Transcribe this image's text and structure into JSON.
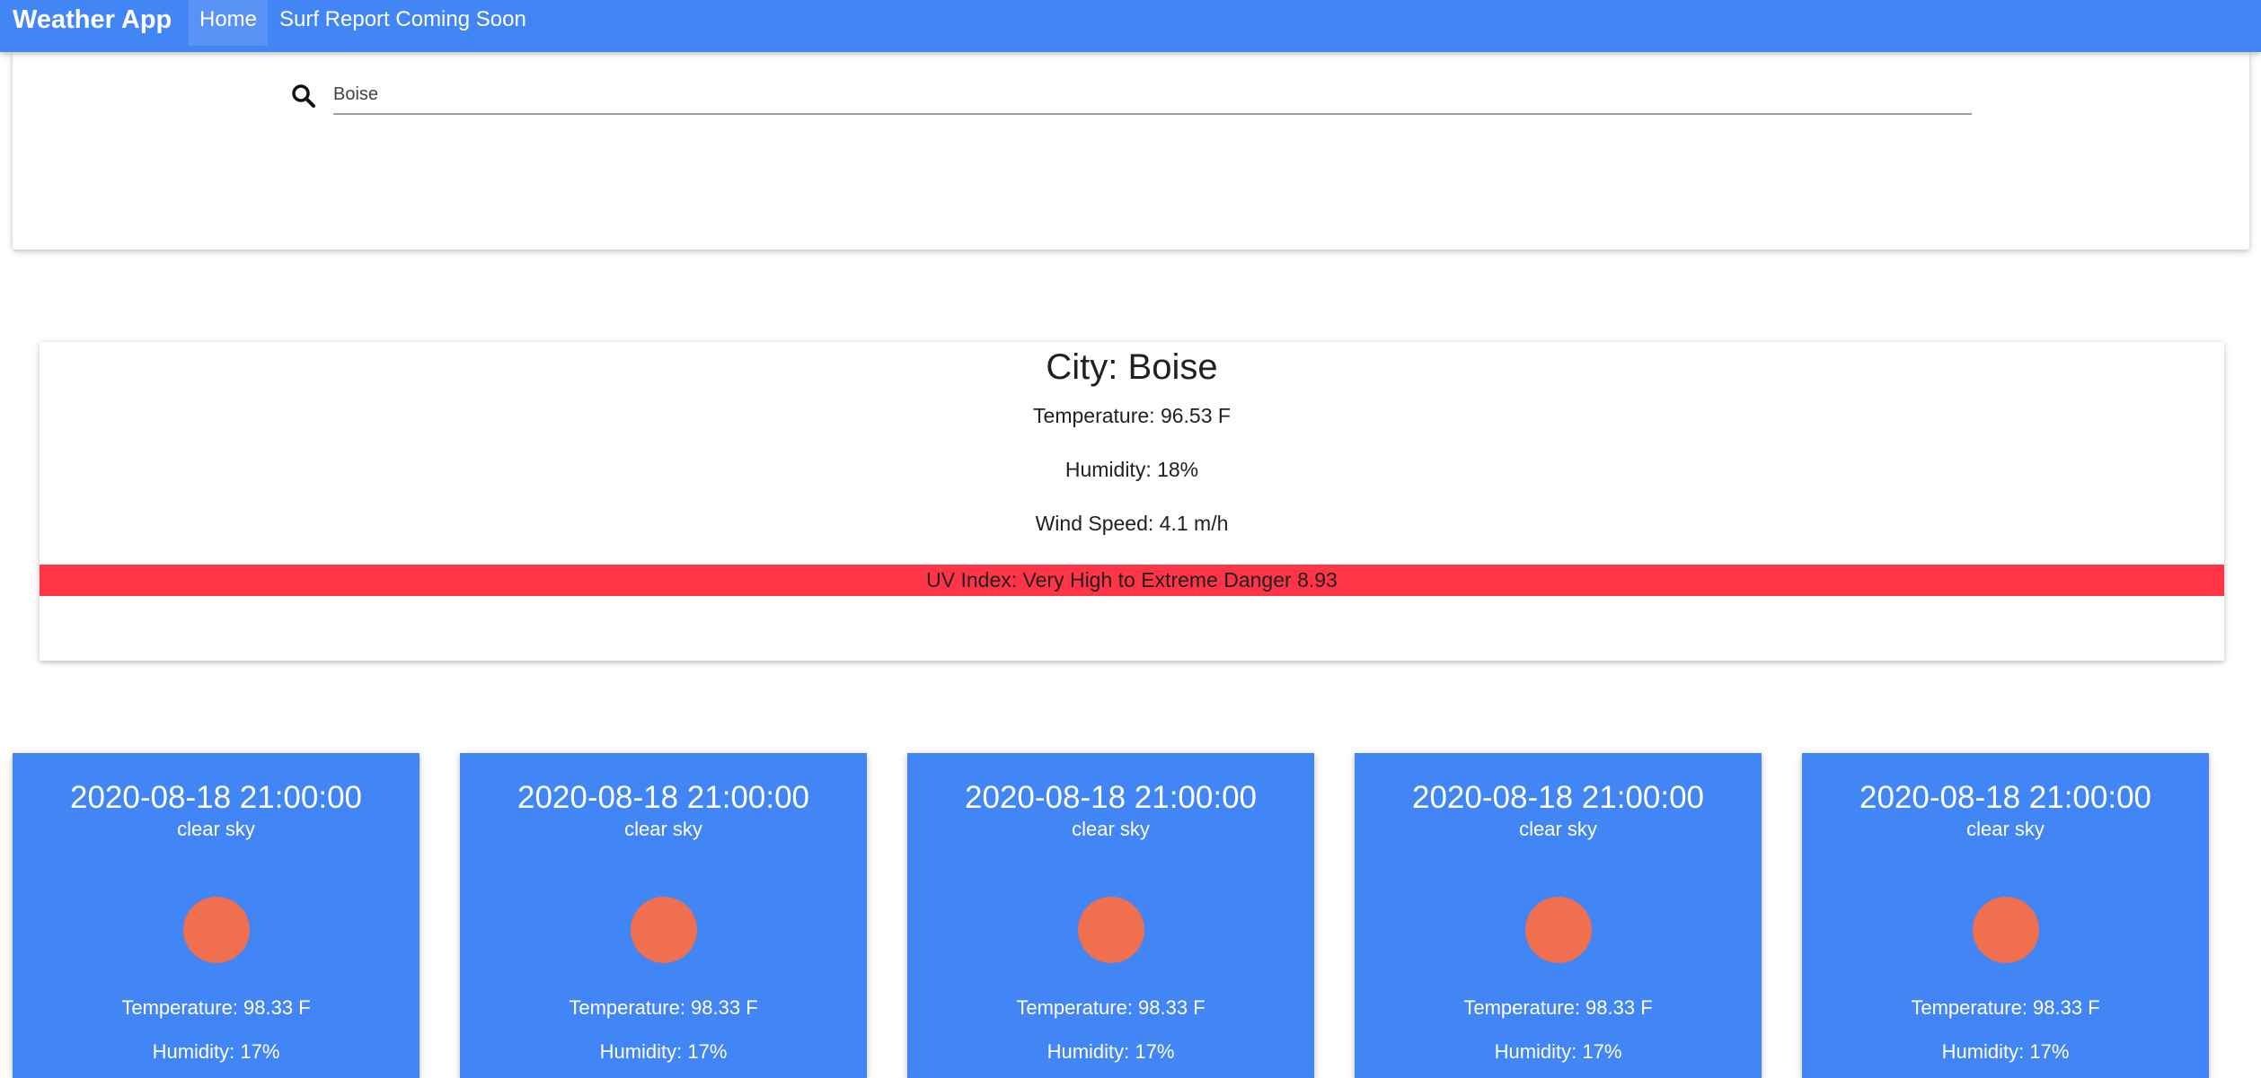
{
  "navbar": {
    "brand": "Weather App",
    "links": [
      {
        "label": "Home",
        "active": true
      },
      {
        "label": "Surf Report Coming Soon",
        "active": false
      }
    ],
    "color": "#4285f4"
  },
  "search": {
    "value": "Boise",
    "icon": "search-icon"
  },
  "current": {
    "city": "City: Boise",
    "temperature": "Temperature: 96.53 F",
    "humidity": "Humidity: 18%",
    "wind_speed": "Wind Speed: 4.1 m/h",
    "uv_index": "UV Index: Very High to Extreme Danger 8.93",
    "uv_color": "#ff3547"
  },
  "forecast": [
    {
      "date": "2020-08-18 21:00:00",
      "description": "clear sky",
      "icon": "sun-icon",
      "temperature": "Temperature: 98.33 F",
      "humidity": "Humidity: 17%"
    },
    {
      "date": "2020-08-18 21:00:00",
      "description": "clear sky",
      "icon": "sun-icon",
      "temperature": "Temperature: 98.33 F",
      "humidity": "Humidity: 17%"
    },
    {
      "date": "2020-08-18 21:00:00",
      "description": "clear sky",
      "icon": "sun-icon",
      "temperature": "Temperature: 98.33 F",
      "humidity": "Humidity: 17%"
    },
    {
      "date": "2020-08-18 21:00:00",
      "description": "clear sky",
      "icon": "sun-icon",
      "temperature": "Temperature: 98.33 F",
      "humidity": "Humidity: 17%"
    },
    {
      "date": "2020-08-18 21:00:00",
      "description": "clear sky",
      "icon": "sun-icon",
      "temperature": "Temperature: 98.33 F",
      "humidity": "Humidity: 17%"
    }
  ],
  "colors": {
    "card": "#4285f4",
    "sun": "#ef6f4e"
  }
}
